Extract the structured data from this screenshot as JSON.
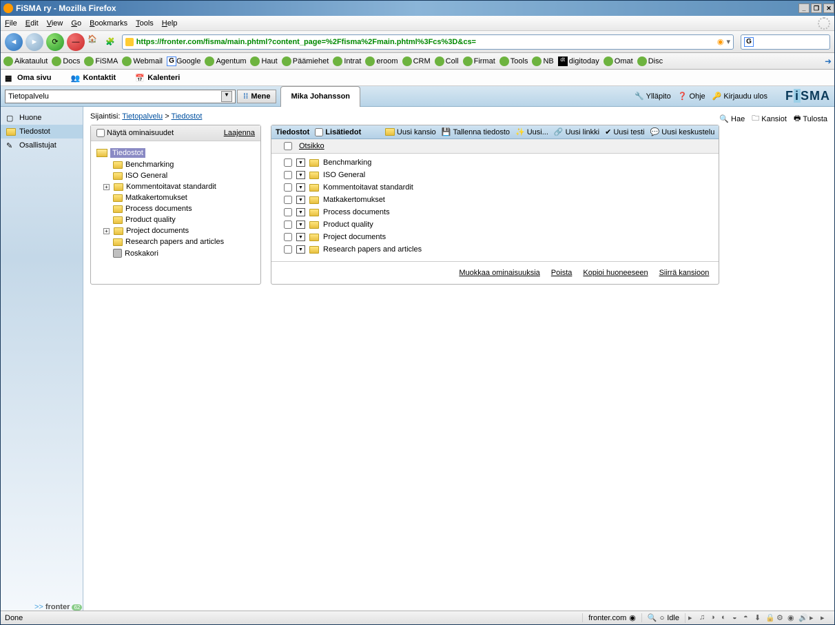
{
  "window": {
    "title": "FiSMA ry - Mozilla Firefox"
  },
  "menubar": [
    "File",
    "Edit",
    "View",
    "Go",
    "Bookmarks",
    "Tools",
    "Help"
  ],
  "url": "https://fronter.com/fisma/main.phtml?content_page=%2Ffisma%2Fmain.phtml%3Fcs%3D&cs=",
  "bookmarks": [
    "Aikataulut",
    "Docs",
    "FiSMA",
    "Webmail",
    "Google",
    "Agentum",
    "Haut",
    "Päämiehet",
    "Intrat",
    "eroom",
    "CRM",
    "Coll",
    "Firmat",
    "Tools",
    "NB",
    "digitoday",
    "Omat",
    "Disc"
  ],
  "topnav": {
    "oma": "Oma sivu",
    "kontaktit": "Kontaktit",
    "kalenteri": "Kalenteri"
  },
  "room": {
    "selected": "Tietopalvelu",
    "go": "Mene",
    "user": "Mika Johansson"
  },
  "userlinks": {
    "admin": "Ylläpito",
    "help": "Ohje",
    "logout": "Kirjaudu ulos"
  },
  "logo": "FiSMA",
  "leftnav": {
    "huone": "Huone",
    "tiedostot": "Tiedostot",
    "osallistujat": "Osallistujat"
  },
  "breadcrumb": {
    "prefix": "Sijaintisi:",
    "a": "Tietopalvelu",
    "sep": ">",
    "b": "Tiedostot"
  },
  "topactions": {
    "hae": "Hae",
    "kansiot": "Kansiot",
    "tulosta": "Tulosta"
  },
  "treehead": {
    "show": "Näytä ominaisuudet",
    "expand": "Laajenna"
  },
  "tree": {
    "root": "Tiedostot",
    "items": [
      "Benchmarking",
      "ISO General",
      "Kommentoitavat standardit",
      "Matkakertomukset",
      "Process documents",
      "Product quality",
      "Project documents",
      "Research papers and articles",
      "Roskakori"
    ],
    "expandable": [
      false,
      false,
      true,
      false,
      false,
      false,
      true,
      false,
      false
    ],
    "trash_index": 8
  },
  "filehead": {
    "tab": "Tiedostot",
    "extra": "Lisätiedot",
    "actions": {
      "newfolder": "Uusi kansio",
      "save": "Tallenna tiedosto",
      "new": "Uusi...",
      "link": "Uusi linkki",
      "test": "Uusi testi",
      "discuss": "Uusi keskustelu"
    },
    "col": "Otsikko"
  },
  "files": [
    "Benchmarking",
    "ISO General",
    "Kommentoitavat standardit",
    "Matkakertomukset",
    "Process documents",
    "Product quality",
    "Project documents",
    "Research papers and articles"
  ],
  "fileactions": {
    "edit": "Muokkaa ominaisuuksia",
    "del": "Poista",
    "copy": "Kopioi huoneeseen",
    "move": "Siirrä kansioon"
  },
  "brand": {
    "pre": ">>",
    "name": "fronter"
  },
  "status": {
    "done": "Done",
    "host": "fronter.com",
    "idle": "Idle"
  }
}
